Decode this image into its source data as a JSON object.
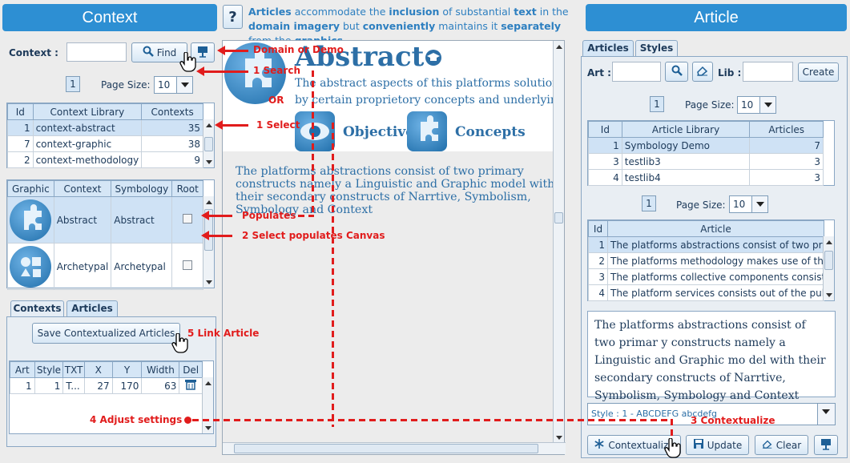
{
  "left": {
    "header": "Context",
    "context_label": "Context :",
    "context_value": "",
    "find_label": "Find",
    "page_number": "1",
    "page_size_label": "Page Size:",
    "page_size_value": "10",
    "context_table": {
      "headers": [
        "Id",
        "Context Library",
        "Contexts"
      ],
      "rows": [
        {
          "id": "1",
          "name": "context-abstract",
          "count": "35"
        },
        {
          "id": "7",
          "name": "context-graphic",
          "count": "38"
        },
        {
          "id": "2",
          "name": "context-methodology",
          "count": "9"
        }
      ]
    },
    "graphic_table": {
      "headers": [
        "Graphic",
        "Context",
        "Symbology",
        "Root"
      ],
      "rows": [
        {
          "context": "Abstract",
          "symbology": "Abstract"
        },
        {
          "context": "Archetypal",
          "symbology": "Archetypal"
        }
      ]
    },
    "tabs": [
      "Contexts",
      "Articles"
    ],
    "save_button": "Save Contextualized Articles",
    "articles_table": {
      "headers": [
        "Art",
        "Style",
        "TXT",
        "X",
        "Y",
        "Width",
        "Del"
      ],
      "rows": [
        {
          "art": "1",
          "style": "1",
          "txt": "T...",
          "x": "27",
          "y": "170",
          "width": "63"
        }
      ]
    }
  },
  "center": {
    "help_glyph": "?",
    "info_parts": [
      {
        "t": "Articles",
        "b": true
      },
      {
        "t": " accommodate the ",
        "b": false
      },
      {
        "t": "inclusion",
        "b": true
      },
      {
        "t": " of substantial ",
        "b": false
      },
      {
        "t": "text",
        "b": true
      },
      {
        "t": " in the ",
        "b": false
      },
      {
        "t": "domain imagery",
        "b": true
      },
      {
        "t": " but ",
        "b": false
      },
      {
        "t": "conveniently",
        "b": true
      },
      {
        "t": " maintains it ",
        "b": false
      },
      {
        "t": "separately",
        "b": true
      },
      {
        "t": " from the ",
        "b": false
      },
      {
        "t": "graphics",
        "b": true
      }
    ],
    "canvas": {
      "title": "Abstract",
      "desc_line1": "The abstract aspects of this platforms solution is define",
      "desc_line2": "by certain proprietory concepts and underlying constru",
      "link_objective": "Objective",
      "link_concepts": "Concepts",
      "article_text": "The platforms abstractions consist of two primary constructs namely a Linguistic and Graphic model with their secondary constructs of Narrtive, Symbolism, Symbology and Context"
    }
  },
  "right": {
    "header": "Article",
    "tabs": [
      "Articles",
      "Styles"
    ],
    "art_label": "Art :",
    "lib_label": "Lib :",
    "create_label": "Create",
    "page_number_1": "1",
    "page_size_label": "Page Size:",
    "page_size_value_1": "10",
    "library_table": {
      "headers": [
        "Id",
        "Article Library",
        "Articles"
      ],
      "rows": [
        {
          "id": "1",
          "name": "Symbology Demo",
          "count": "7"
        },
        {
          "id": "3",
          "name": "testlib3",
          "count": "3"
        },
        {
          "id": "4",
          "name": "testlib4",
          "count": "3"
        }
      ]
    },
    "page_number_2": "1",
    "page_size_value_2": "10",
    "article_table": {
      "headers": [
        "Id",
        "Article"
      ],
      "rows": [
        {
          "id": "1",
          "text": "The platforms abstractions consist of two prim..."
        },
        {
          "id": "2",
          "text": "The platforms methodology makes use of thre..."
        },
        {
          "id": "3",
          "text": "The platforms collective components consists ..."
        },
        {
          "id": "4",
          "text": "The platform services consists out of the publi..."
        }
      ]
    },
    "preview_text": "The platforms abstractions consist of two primar y constructs namely a Linguistic and Graphic mo del with their secondary constructs of  Narrtive, Symbolism, Symbology and Context",
    "style_value": "Style : 1 - ABCDEFG abcdefg",
    "contextualize_label": "Contextualize",
    "update_label": "Update",
    "clear_label": "Clear"
  },
  "annotations": {
    "domain_demo": "Domain or Demo",
    "search": "1 Search",
    "or": "OR",
    "select": "1 Select",
    "populates": "Populates",
    "select_canvas": "2 Select populates Canvas",
    "link_article": "5 Link Article",
    "adjust": "4 Adjust settings",
    "contextualize": "3 Contextualize"
  },
  "colors": {
    "header_blue": "#2d8fd3",
    "annotation_red": "#e11c1c",
    "text_navy": "#1d3a5a"
  }
}
